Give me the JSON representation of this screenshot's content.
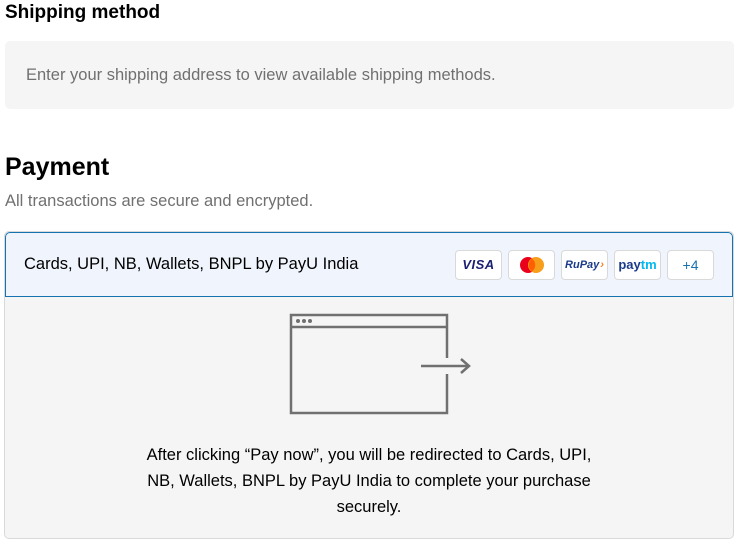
{
  "shipping": {
    "title": "Shipping method",
    "placeholder_text": "Enter your shipping address to view available shipping methods."
  },
  "payment": {
    "title": "Payment",
    "subtitle": "All transactions are secure and encrypted.",
    "option": {
      "label": "Cards, UPI, NB, Wallets, BNPL by PayU India",
      "badges": {
        "visa": "VISA",
        "mastercard": "mastercard-icon",
        "rupay": "RuPay",
        "paytm_pay": "pay",
        "paytm_tm": "tm",
        "more": "+4"
      }
    },
    "redirect_message": "After clicking “Pay now”, you will be redirected to Cards, UPI, NB, Wallets, BNPL by PayU India to complete your purchase securely."
  },
  "colors": {
    "accent": "#1773b0",
    "selected_bg": "#f0f5fd",
    "panel_bg": "#f5f5f5",
    "muted_text": "#707070"
  }
}
